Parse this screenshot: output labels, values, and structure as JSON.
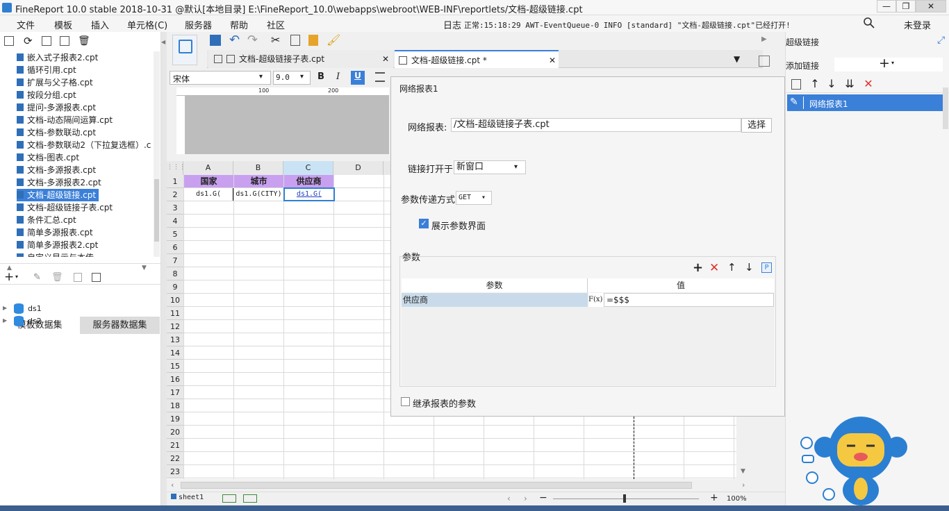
{
  "titlebar": {
    "title": "FineReport 10.0 stable 2018-10-31 @默认[本地目录]    E:\\FineReport_10.0\\webapps\\webroot\\WEB-INF\\reportlets/文档-超级链接.cpt",
    "min": "—",
    "max": "❐",
    "close": "✕"
  },
  "menubar": {
    "items": [
      "文件",
      "模板",
      "插入",
      "单元格(C)",
      "服务器",
      "帮助",
      "社区"
    ],
    "log": "日志",
    "status": "正常:15:18:29 AWT-EventQueue-0 INFO [standard] \"文档-超级链接.cpt\"已经打开!",
    "login": "未登录"
  },
  "filetree": {
    "files": [
      "嵌入式子报表2.cpt",
      "循环引用.cpt",
      "扩展与父子格.cpt",
      "按段分组.cpt",
      "提问-多源报表.cpt",
      "文档-动态隔间运算.cpt",
      "文档-参数联动.cpt",
      "文档-参数联动2（下拉复选框）.c",
      "文档-图表.cpt",
      "文档-多源报表.cpt",
      "文档-多源报表2.cpt",
      "文档-超级链接.cpt",
      "文档-超级链接子表.cpt",
      "条件汇总.cpt",
      "简单多源报表.cpt",
      "简单多源报表2.cpt",
      "自定义显示与本传"
    ],
    "selected_index": 11
  },
  "datasets": {
    "tabs": [
      "模板数据集",
      "服务器数据集"
    ],
    "items": [
      "ds1",
      "ds2"
    ]
  },
  "doctabs": [
    {
      "label": "文档-超级链接子表.cpt"
    },
    {
      "label": "文档-超级链接.cpt *"
    }
  ],
  "format": {
    "font": "宋体",
    "size": "9.0"
  },
  "ruler": {
    "marks": [
      "100",
      "200"
    ]
  },
  "sheet": {
    "columns": [
      "A",
      "B",
      "C",
      "D"
    ],
    "rows": [
      "1",
      "2",
      "3",
      "4",
      "5",
      "6",
      "7",
      "8",
      "9",
      "10",
      "11",
      "12",
      "13",
      "14",
      "15",
      "16",
      "17",
      "18",
      "19",
      "20",
      "21",
      "22",
      "23"
    ],
    "header": [
      "国家",
      "城市",
      "供应商"
    ],
    "row2": [
      "ds1.G(",
      "ds1.G(CITY)",
      "ds1.G("
    ],
    "tab": "sheet1",
    "zoom": "100%"
  },
  "dialog": {
    "title": "网络报表1",
    "report_label": "网络报表:",
    "report_value": "/文档-超级链接子表.cpt",
    "choose": "选择",
    "open_label": "链接打开于",
    "open_value": "新窗口",
    "method_label": "参数传递方式",
    "method_value": "GET",
    "show_params": "展示参数界面",
    "params_section": "参数",
    "col_param": "参数",
    "col_value": "值",
    "row_param": "供应商",
    "row_value": "=$$$",
    "fx": "F(x)",
    "inherit": "继承报表的参数"
  },
  "rightpanel": {
    "title": "超级链接",
    "add_label": "添加链接",
    "link_item": "网络报表1"
  },
  "colors": {
    "accent": "#3a7fd8",
    "header_fill": "#c9a0f0",
    "red": "#e0312a"
  }
}
